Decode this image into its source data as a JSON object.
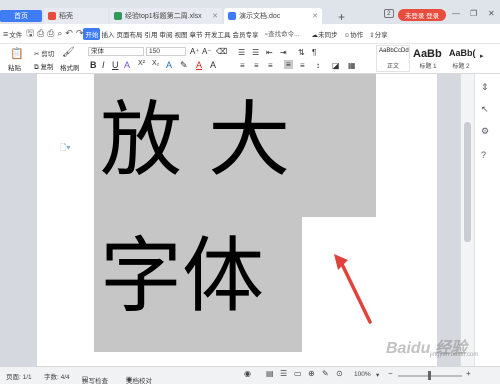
{
  "tabs": {
    "home": "首页",
    "t1": "稻壳",
    "t2": "经验top1标题第二周.xlsx",
    "t3": "演示文档.doc"
  },
  "window": {
    "badge": "2",
    "login": "未登录 登录"
  },
  "menu": {
    "file": "文件",
    "items": [
      "开始",
      "插入",
      "页面布局",
      "引用",
      "审阅",
      "视图",
      "章节",
      "开发工具",
      "会员专享"
    ],
    "search": "查找命令...",
    "unsynced": "未同步",
    "collab": "协作",
    "share": "分享"
  },
  "ribbon": {
    "cut": "剪切",
    "copy": "复制",
    "paste": "粘贴",
    "format_painter": "格式刷",
    "font_name": "宋体",
    "font_size": "150",
    "styles": [
      {
        "preview": "AaBbCcDd",
        "label": "正文"
      },
      {
        "preview": "AaBb",
        "label": "标题 1"
      },
      {
        "preview": "AaBb(",
        "label": "标题 2"
      }
    ]
  },
  "document": {
    "line1": "放 大",
    "line2": "字体"
  },
  "status": {
    "page": "页面: 1/1",
    "words": "字数: 4/4",
    "spell": "拼写检查",
    "doc_check": "文档校对",
    "zoom": "100%"
  },
  "watermark": {
    "text": "Baidu 经验",
    "sub": "jingyan.baidu.com"
  },
  "colors": {
    "accent": "#3d7cf4",
    "login": "#e84c3d",
    "selection": "#c6c6c6",
    "arrow": "#e0433a"
  }
}
